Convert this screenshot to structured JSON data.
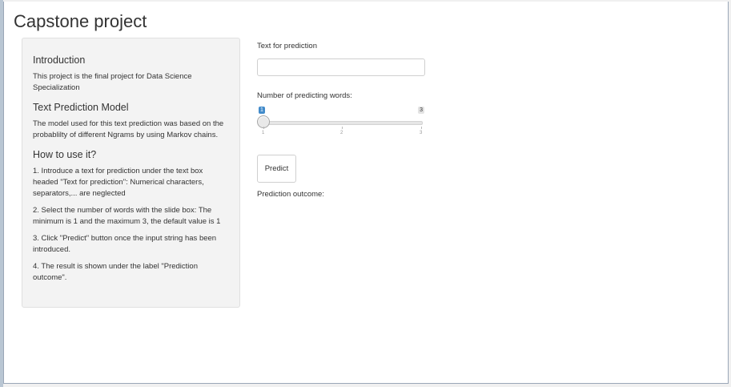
{
  "page": {
    "title": "Capstone project"
  },
  "sidebar": {
    "sections": [
      {
        "heading": "Introduction",
        "paragraphs": [
          "This project is the final project for Data Science Specialization"
        ]
      },
      {
        "heading": "Text Prediction Model",
        "paragraphs": [
          "The model used for this text prediction was based on the probablilty of different Ngrams by using Markov chains."
        ]
      },
      {
        "heading": "How to use it?",
        "paragraphs": [
          "1. Introduce a text for prediction under the text box headed \"Text for prediction\": Numerical characters, separators,... are neglected",
          "2. Select the number of words with the slide box: The minimum is 1 and the maximum 3, the default value is 1",
          "3. Click \"Predict\" button once the input string has been introduced.",
          "4. The result is shown under the label \"Prediction outcome\"."
        ]
      }
    ]
  },
  "main": {
    "text_input": {
      "label": "Text for prediction",
      "value": "",
      "placeholder": ""
    },
    "slider": {
      "label": "Number of predicting words:",
      "min": 1,
      "max": 3,
      "value": 1,
      "min_badge": "1",
      "max_badge": "3",
      "tick_labels": [
        "1",
        "2",
        "3"
      ]
    },
    "predict_button": {
      "label": "Predict"
    },
    "outcome": {
      "label": "Prediction outcome:",
      "value": ""
    }
  },
  "colors": {
    "accent": "#428bca",
    "panel_bg": "#f3f3f3"
  }
}
